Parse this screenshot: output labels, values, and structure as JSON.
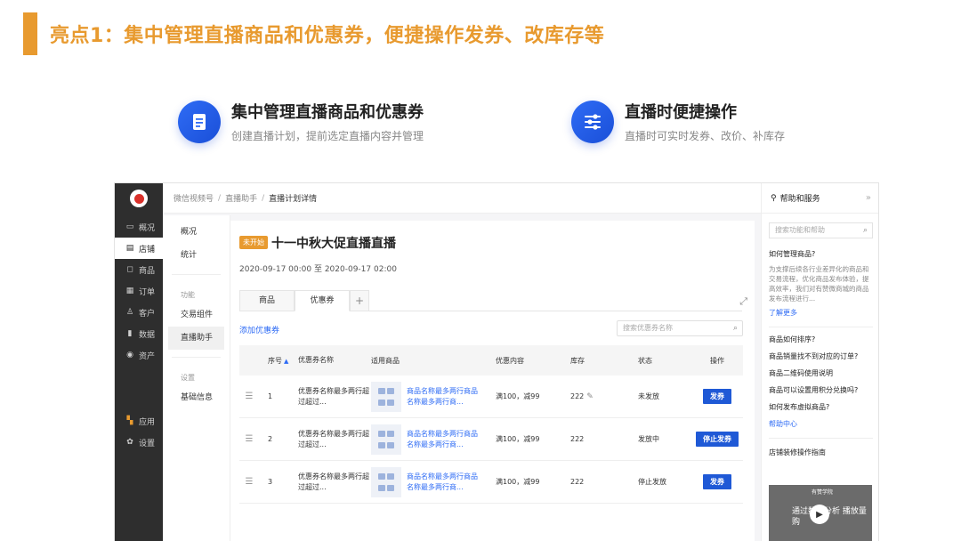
{
  "slide": {
    "title": "亮点1：集中管理直播商品和优惠券，便捷操作发券、改库存等",
    "accent_color": "#e89a2f",
    "features": [
      {
        "icon": "document-icon",
        "title": "集中管理直播商品和优惠券",
        "subtitle": "创建直播计划，提前选定直播内容并管理"
      },
      {
        "icon": "sliders-icon",
        "title": "直播时便捷操作",
        "subtitle": "直播时可实时发券、改价、补库存"
      }
    ]
  },
  "app": {
    "left_nav": [
      {
        "icon": "overview-icon",
        "label": "概况"
      },
      {
        "icon": "store-icon",
        "label": "店铺",
        "active": true
      },
      {
        "icon": "goods-icon",
        "label": "商品"
      },
      {
        "icon": "order-icon",
        "label": "订单"
      },
      {
        "icon": "customer-icon",
        "label": "客户"
      },
      {
        "icon": "data-icon",
        "label": "数据"
      },
      {
        "icon": "assets-icon",
        "label": "资产"
      }
    ],
    "left_nav_bottom": [
      {
        "icon": "apps-icon",
        "label": "应用"
      },
      {
        "icon": "settings-icon",
        "label": "设置"
      }
    ],
    "breadcrumb": [
      "微信视频号",
      "直播助手",
      "直播计划详情"
    ],
    "sub_nav": {
      "top": [
        "概况",
        "统计"
      ],
      "group1_label": "功能",
      "group1": [
        "交易组件",
        "直播助手"
      ],
      "group2_label": "设置",
      "group2": [
        "基础信息"
      ]
    },
    "plan": {
      "badge": "未开始",
      "title": "十一中秋大促直播直播",
      "time": "2020-09-17 00:00 至 2020-09-17 02:00"
    },
    "tabs": [
      "商品",
      "优惠券",
      "+"
    ],
    "add_coupon": "添加优惠券",
    "coupon_search_placeholder": "搜索优惠券名称",
    "table": {
      "headers": [
        "序号",
        "优惠券名称",
        "适用商品",
        "优惠内容",
        "库存",
        "状态",
        "操作"
      ],
      "rows": [
        {
          "no": "1",
          "name": "优惠券名称最多两行超过超过...",
          "goods": "商品名称最多两行商品名称最多两行商...",
          "discount": "满100，减99",
          "stock": "222",
          "status": "未发放",
          "action": "发券"
        },
        {
          "no": "2",
          "name": "优惠券名称最多两行超过超过...",
          "goods": "商品名称最多两行商品名称最多两行商...",
          "discount": "满100，减99",
          "stock": "222",
          "status": "发放中",
          "action": "停止发券"
        },
        {
          "no": "3",
          "name": "优惠券名称最多两行超过超过...",
          "goods": "商品名称最多两行商品名称最多两行商...",
          "discount": "满100，减99",
          "stock": "222",
          "status": "停止发放",
          "action": "发券"
        }
      ]
    },
    "help": {
      "title": "帮助和服务",
      "search_placeholder": "搜索功能和帮助",
      "q1": "如何管理商品?",
      "q1_body": "为支撑后续各行业差异化的商品和交易流程，优化商品发布体验，提高效率，我们对有赞微商城的商品发布流程进行...",
      "q1_link": "了解更多",
      "questions": [
        "商品如何排序?",
        "商品销量找不到对应的订单?",
        "商品二维码使用说明",
        "商品可以设置用积分兑换吗?",
        "如何发布虚拟商品?"
      ],
      "help_center": "帮助中心",
      "guide_title": "店铺装修操作指南",
      "video_brand": "有赞学院",
      "video_text": "通过数据分析 播放量购"
    }
  }
}
